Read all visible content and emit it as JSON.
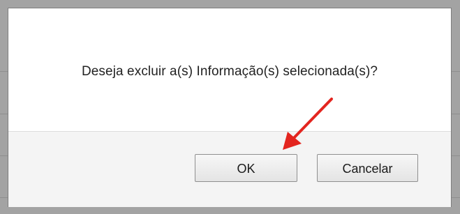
{
  "dialog": {
    "message": "Deseja excluir a(s) Informação(s) selecionada(s)?",
    "ok_label": "OK",
    "cancel_label": "Cancelar"
  },
  "annotation": {
    "arrow_icon": "red-arrow-icon",
    "arrow_color": "#e3251f"
  }
}
